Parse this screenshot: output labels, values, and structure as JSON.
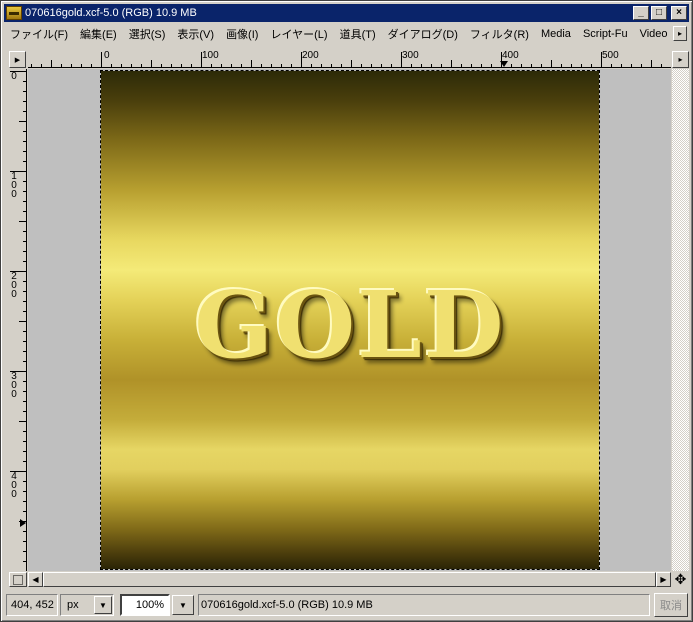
{
  "window": {
    "title": "070616gold.xcf-5.0 (RGB) 10.9 MB",
    "controls": {
      "minimize": "_",
      "maximize": "□",
      "close": "×"
    }
  },
  "menubar": {
    "items": [
      "ファイル(F)",
      "編集(E)",
      "選択(S)",
      "表示(V)",
      "画像(I)",
      "レイヤー(L)",
      "道具(T)",
      "ダイアログ(D)",
      "フィルタ(R)",
      "Media",
      "Script-Fu",
      "Video"
    ]
  },
  "rulers": {
    "horizontal_labels": [
      "0",
      "100",
      "200",
      "300",
      "400",
      "500"
    ],
    "vertical_labels": [
      "0",
      "100",
      "200",
      "300",
      "400"
    ]
  },
  "canvas": {
    "image_text": "GOLD",
    "colors": {
      "gold_light": "#f4ea78",
      "gold_dark": "#2c2a08",
      "canvas_bg": "#bfbfbf"
    }
  },
  "statusbar": {
    "coords": "404, 452",
    "unit": "px",
    "zoom": "100%",
    "message": "070616gold.xcf-5.0 (RGB) 10.9 MB",
    "cancel_label": "取消"
  },
  "icons": {
    "menu_arrow": "▸",
    "dropdown": "▼",
    "scroll_left": "◀",
    "scroll_right": "▶",
    "navigate": "✥"
  }
}
